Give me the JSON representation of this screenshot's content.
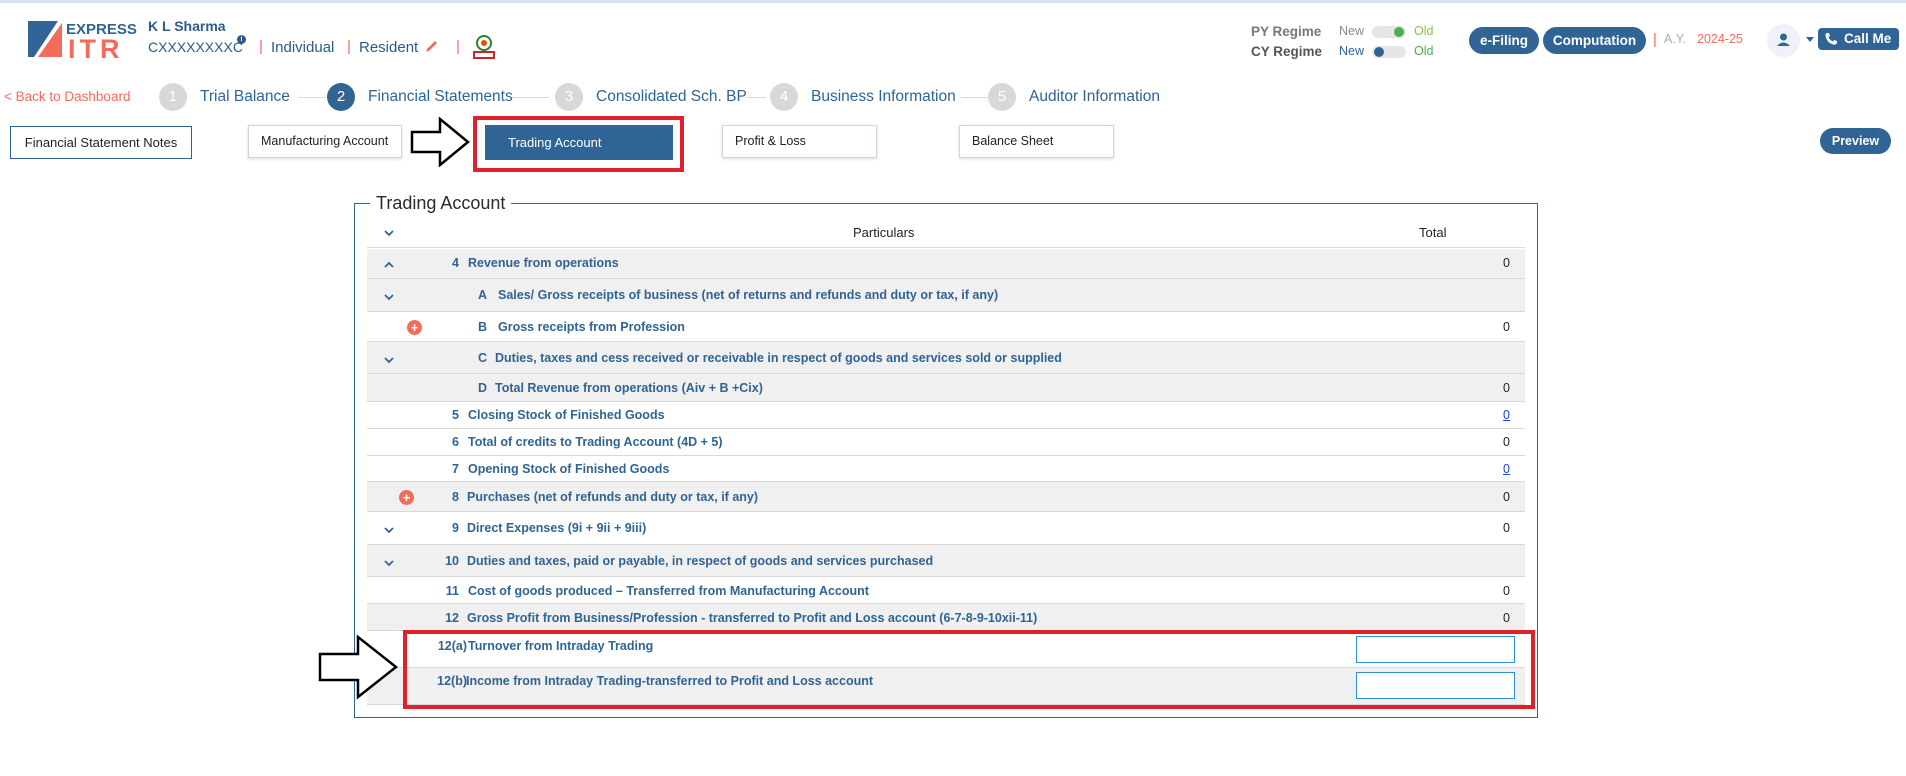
{
  "header": {
    "logo_top": "EXPRESS",
    "logo_bottom": "ITR",
    "user_name": "K L Sharma",
    "user_pan": "CXXXXXXXXC",
    "user_type": "Individual",
    "user_residency": "Resident",
    "sep": "|",
    "py_regime_label": "PY Regime",
    "cy_regime_label": "CY Regime",
    "new_label": "New",
    "old_label": "Old",
    "efiling_label": "e-Filing",
    "computation_label": "Computation",
    "ay_label": "A.Y.",
    "ay_value": "2024-25",
    "call_me_label": "Call Me"
  },
  "nav": {
    "back_label": "< Back to Dashboard",
    "steps": [
      {
        "num": "1",
        "label": "Trial Balance"
      },
      {
        "num": "2",
        "label": "Financial Statements"
      },
      {
        "num": "3",
        "label": "Consolidated Sch. BP"
      },
      {
        "num": "4",
        "label": "Business Information"
      },
      {
        "num": "5",
        "label": "Auditor Information"
      }
    ]
  },
  "tabs": {
    "notes": "Financial Statement Notes",
    "manufacturing": "Manufacturing Account",
    "trading": "Trading Account",
    "profit_loss": "Profit & Loss",
    "balance_sheet": "Balance Sheet",
    "preview": "Preview"
  },
  "table": {
    "title": "Trading Account",
    "col_particulars": "Particulars",
    "col_total": "Total",
    "rows": [
      {
        "num": "4",
        "text": "Revenue from operations",
        "value": "0"
      },
      {
        "num": "A",
        "text": "Sales/ Gross receipts of business (net of returns and refunds and duty or tax, if any)",
        "value": ""
      },
      {
        "num": "B",
        "text": "Gross receipts from Profession",
        "value": "0"
      },
      {
        "num": "C",
        "text": "Duties, taxes and cess received or receivable in respect of goods and services sold or supplied",
        "value": ""
      },
      {
        "num": "D",
        "text": "Total Revenue from operations (Aiv + B +Cix)",
        "value": "0"
      },
      {
        "num": "5",
        "text": "Closing Stock of Finished Goods",
        "value": "0"
      },
      {
        "num": "6",
        "text": "Total of credits to Trading Account (4D + 5)",
        "value": "0"
      },
      {
        "num": "7",
        "text": "Opening Stock of Finished Goods",
        "value": "0"
      },
      {
        "num": "8",
        "text": "Purchases (net of refunds and duty or tax, if any)",
        "value": "0"
      },
      {
        "num": "9",
        "text": "Direct Expenses (9i + 9ii + 9iii)",
        "value": "0"
      },
      {
        "num": "10",
        "text": "Duties and taxes, paid or payable, in respect of goods and services purchased",
        "value": ""
      },
      {
        "num": "11",
        "text": "Cost of goods produced – Transferred from Manufacturing Account",
        "value": "0"
      },
      {
        "num": "12",
        "text": "Gross Profit from Business/Profession - transferred to Profit and Loss account (6-7-8-9-10xii-11)",
        "value": "0"
      },
      {
        "num": "12(a)",
        "text": "Turnover from Intraday Trading",
        "value": ""
      },
      {
        "num": "12(b)",
        "text": "Income from Intraday Trading-transferred to Profit and Loss account",
        "value": ""
      }
    ]
  },
  "colors": {
    "primary": "#2f6494",
    "accent": "#f26b5b",
    "highlight": "#e0202a",
    "toggle_on": "#4caf50"
  }
}
